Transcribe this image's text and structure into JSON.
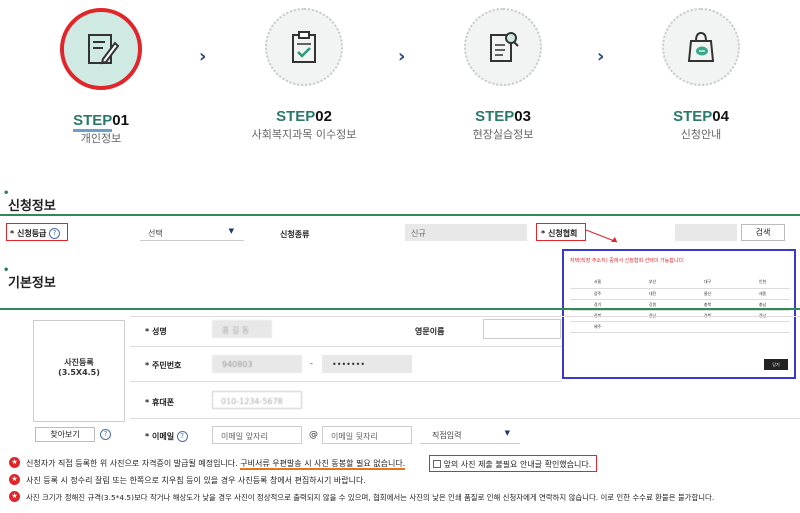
{
  "steps": [
    {
      "step_word": "STEP",
      "num": "01",
      "label": "개인정보"
    },
    {
      "step_word": "STEP",
      "num": "02",
      "label": "사회복지과목 이수정보"
    },
    {
      "step_word": "STEP",
      "num": "03",
      "label": "현장실습정보"
    },
    {
      "step_word": "STEP",
      "num": "04",
      "label": "신청안내"
    }
  ],
  "chevron": "›",
  "section1": {
    "title": "신청정보",
    "grade_label": "* 신청등급",
    "grade_select": "선택",
    "type_label": "신청종류",
    "type_value": "신규",
    "assoc_label": "* 신청협회",
    "search_button": "검색"
  },
  "popup": {
    "title": "자택(직장 주소지) 중에서 신청협회 선택이 가능합니다.",
    "regions": [
      [
        "서울",
        "부산",
        "대구",
        "인천"
      ],
      [
        "광주",
        "대전",
        "울산",
        "세종"
      ],
      [
        "경기",
        "강원",
        "충북",
        "충남"
      ],
      [
        "전북",
        "전남",
        "경북",
        "경남"
      ],
      [
        "제주",
        "",
        "",
        ""
      ]
    ],
    "close_button": "닫기"
  },
  "section2": {
    "title": "기본정보",
    "photo_label": "사진등록\n(3.5X4.5)",
    "browse_button": "찾아보기",
    "name_label": "* 성명",
    "name_value": "홍 길 동",
    "eng_name_label": "영문이름",
    "rrn_label": "* 주민번호",
    "rrn_front": "940803",
    "rrn_sep": "-",
    "rrn_back": "•••••••",
    "phone_label": "* 휴대폰",
    "phone_value": "010-1234-5678",
    "email_label": "* 이메일",
    "email_front_placeholder": "이메일 앞자리",
    "email_at": "@",
    "email_back_placeholder": "이메일 뒷자리",
    "email_domain_select": "직접입력"
  },
  "notes": {
    "n1_prefix": "신청자가 직접 등록한 위 사진으로 자격증이 발급될 예정입니다. ",
    "n1_underline": "구비서류 우편발송 시 사진 동봉할 필요 없습니다.",
    "n1_checkbox": "앞의 사진 제출 불필요 안내글 확인했습니다.",
    "n2": "사진 등록 시 정수리 잘림 또는 한쪽으로 치우침 등이 있을 경우 사진등록 창에서 편집하시기 바랍니다.",
    "n3": "사진 크기가 정해진 규격(3.5*4.5)보다 작거나 해상도가 낮을 경우 사진이 정상적으로 출력되지 않을 수 있으며, 협회에서는 사진의 낮은 인쇄 품질로 인해 신청자에게 연락하지 않습니다. 이로 인한 수수료 환불은 불가합니다."
  },
  "colors": {
    "accent": "#2a7a6c",
    "alert": "#e0262b",
    "popup_border": "#3a3ac8"
  }
}
